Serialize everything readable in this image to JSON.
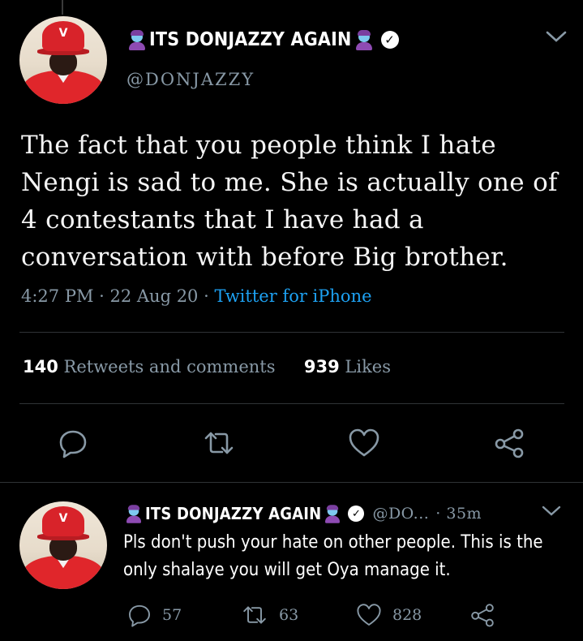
{
  "main_tweet": {
    "display_name": "ITS DONJAZZY AGAIN",
    "handle": "@DONJAZZY",
    "text": "The fact that you people think I hate Nengi is sad to me. She is actually one of 4 contestants that I have had a conversation with before Big brother.",
    "time": "4:27 PM · 22 Aug 20 · ",
    "source": "Twitter for iPhone",
    "retweets_count": "140",
    "retweets_label": "Retweets and comments",
    "likes_count": "939",
    "likes_label": "Likes",
    "avatar_cap_logo": "V"
  },
  "reply_tweet": {
    "display_name": "ITS DONJAZZY AGAIN",
    "handle": "@DO...",
    "time": "· 35m",
    "text": "Pls don't push your hate on other people. This is the only shalaye you will get Oya manage it.",
    "reply_count": "57",
    "retweet_count": "63",
    "like_count": "828",
    "avatar_cap_logo": "V"
  },
  "colors": {
    "background": "#000000",
    "muted": "#8899a6",
    "link": "#1da1f2",
    "divider": "#2f3336"
  }
}
